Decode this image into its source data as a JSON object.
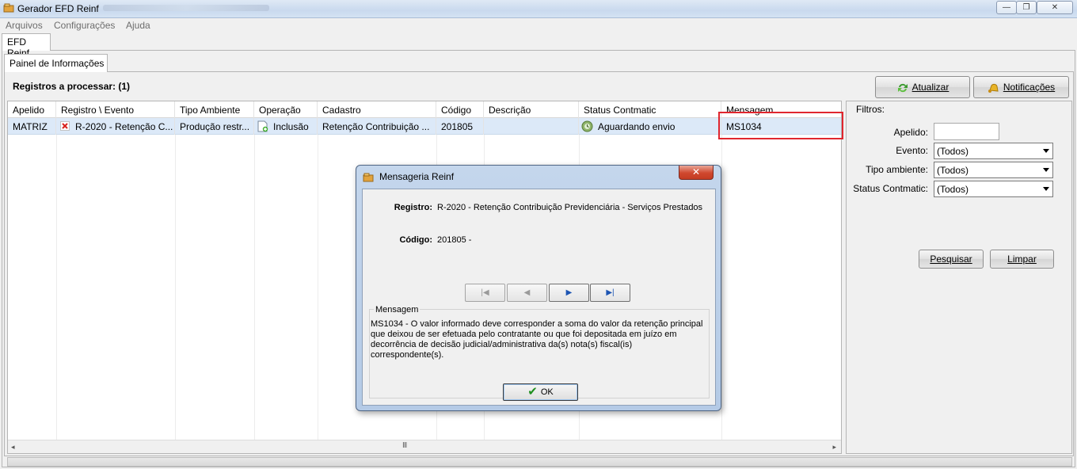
{
  "window": {
    "title": "Gerador EFD Reinf",
    "controls": {
      "minimize": "—",
      "maximize": "❐",
      "close": "✕"
    }
  },
  "menu": {
    "items": [
      "Arquivos",
      "Configurações",
      "Ajuda"
    ]
  },
  "tabs": {
    "outer": "EFD Reinf",
    "inner": "Painel de Informações"
  },
  "summary": {
    "records_label": "Registros a processar: (1)"
  },
  "toolbar": {
    "refresh_label": "Atualizar",
    "notifications_label": "Notificações"
  },
  "grid": {
    "columns": [
      "Apelido",
      "Registro \\ Evento",
      "Tipo Ambiente",
      "Operação",
      "Cadastro",
      "Código",
      "Descrição",
      "Status Contmatic",
      "Mensagem"
    ],
    "rows": [
      {
        "apelido": "MATRIZ",
        "registro": "R-2020 - Retenção C...",
        "tipo_ambiente": "Produção restr...",
        "operacao": "Inclusão",
        "cadastro": "Retenção Contribuição ...",
        "codigo": "201805",
        "descricao": "",
        "status": "Aguardando envio",
        "mensagem": "MS1034"
      }
    ],
    "scroll": {
      "left": "◂",
      "right": "▸",
      "grip": "III"
    }
  },
  "filters": {
    "legend": "Filtros:",
    "apelido_label": "Apelido:",
    "apelido_value": "",
    "evento_label": "Evento:",
    "evento_value": "(Todos)",
    "tipo_ambiente_label": "Tipo ambiente:",
    "tipo_ambiente_value": "(Todos)",
    "status_label": "Status Contmatic:",
    "status_value": "(Todos)",
    "search_label": "Pesquisar",
    "clear_label": "Limpar"
  },
  "dialog": {
    "title": "Mensageria Reinf",
    "close_glyph": "✕",
    "registro_label": "Registro:",
    "registro_value": "R-2020 - Retenção Contribuição Previdenciária - Serviços Prestados",
    "codigo_label": "Código:",
    "codigo_value": "201805 -",
    "nav": {
      "first": "|◀",
      "prev": "◀",
      "next": "▶",
      "last": "▶|"
    },
    "message_legend": "Mensagem",
    "message_text": "MS1034 - O valor informado deve corresponder a soma do valor da retenção principal que deixou de ser efetuada pelo contratante ou que foi depositada em juízo em decorrência de decisão judicial/administrativa da(s) nota(s) fiscal(is) correspondente(s).",
    "ok_label": "OK"
  },
  "colors": {
    "selection": "#dce9f8",
    "highlight_border": "#e0262e",
    "nav_enabled": "#1d55b3"
  }
}
